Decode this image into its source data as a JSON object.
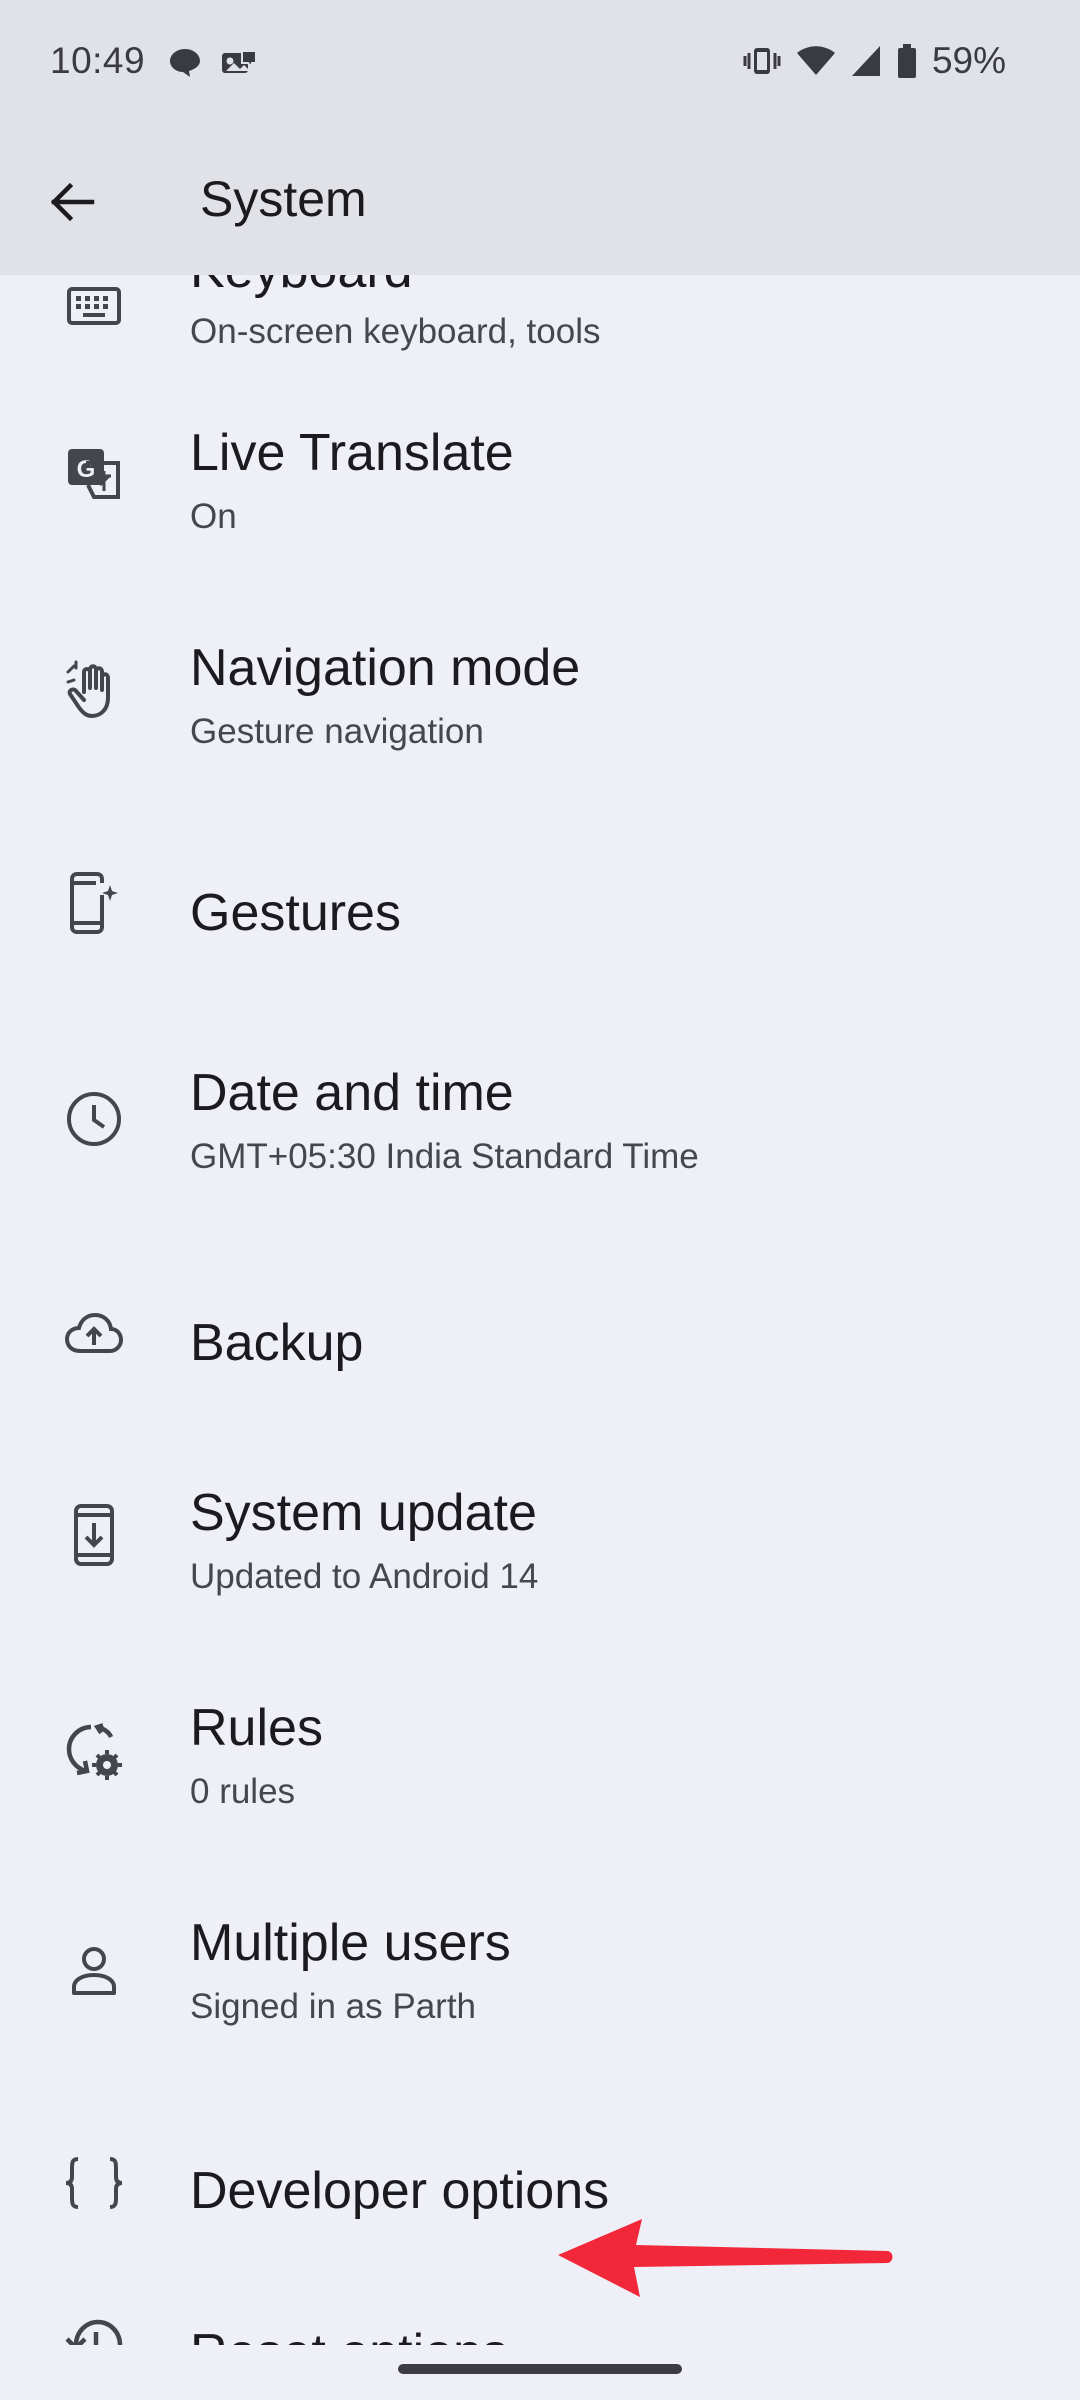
{
  "status_bar": {
    "time": "10:49",
    "notification_icons": [
      "chat-bubble-icon",
      "photo-message-icon"
    ],
    "system_icons": [
      "vibrate-icon",
      "wifi-icon",
      "cellular-signal-icon",
      "battery-icon"
    ],
    "battery_percent": "59%"
  },
  "app_bar": {
    "back_icon": "arrow-back-icon",
    "title": "System"
  },
  "settings": [
    {
      "key": "keyboard",
      "icon": "keyboard-icon",
      "title": "Keyboard",
      "summary": "On-screen keyboard, tools"
    },
    {
      "key": "live-translate",
      "icon": "translate-icon",
      "title": "Live Translate",
      "summary": "On"
    },
    {
      "key": "navigation-mode",
      "icon": "gesture-hand-icon",
      "title": "Navigation mode",
      "summary": "Gesture navigation"
    },
    {
      "key": "gestures",
      "icon": "phone-sparkle-icon",
      "title": "Gestures",
      "summary": ""
    },
    {
      "key": "date-and-time",
      "icon": "clock-icon",
      "title": "Date and time",
      "summary": "GMT+05:30 India Standard Time"
    },
    {
      "key": "backup",
      "icon": "cloud-upload-icon",
      "title": "Backup",
      "summary": ""
    },
    {
      "key": "system-update",
      "icon": "system-update-icon",
      "title": "System update",
      "summary": "Updated to Android 14"
    },
    {
      "key": "rules",
      "icon": "rules-sync-gear-icon",
      "title": "Rules",
      "summary": "0 rules"
    },
    {
      "key": "multiple-users",
      "icon": "person-icon",
      "title": "Multiple users",
      "summary": "Signed in as Parth"
    },
    {
      "key": "developer-options",
      "icon": "curly-braces-icon",
      "title": "Developer options",
      "summary": ""
    },
    {
      "key": "reset-options",
      "icon": "history-icon",
      "title": "Reset options",
      "summary": ""
    }
  ],
  "annotation": {
    "arrow_color": "#f2283a",
    "arrow_points_to": "reset-options"
  },
  "colors": {
    "background": "#eff0f7",
    "app_bar": "#e1e2e7",
    "title_text": "#1b1b1f",
    "summary_text": "#45464f",
    "icon": "#44464e"
  }
}
